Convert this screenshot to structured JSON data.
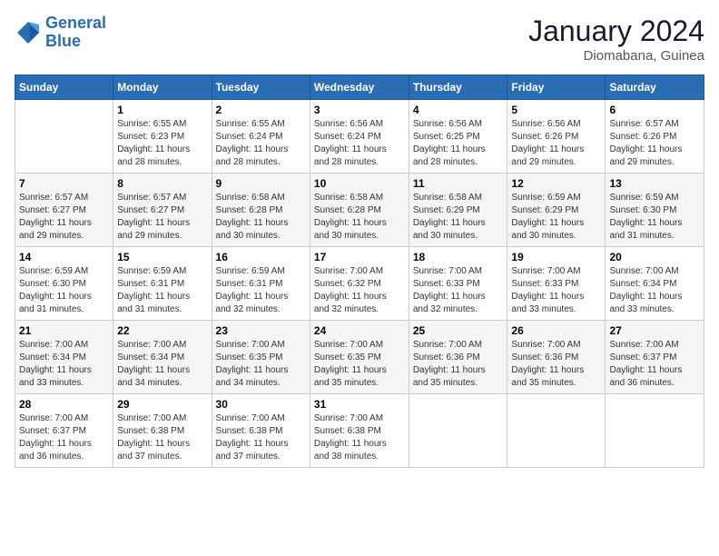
{
  "header": {
    "logo_line1": "General",
    "logo_line2": "Blue",
    "month_year": "January 2024",
    "location": "Diomabana, Guinea"
  },
  "calendar": {
    "days_of_week": [
      "Sunday",
      "Monday",
      "Tuesday",
      "Wednesday",
      "Thursday",
      "Friday",
      "Saturday"
    ],
    "weeks": [
      [
        {
          "day": null
        },
        {
          "day": 1,
          "sunrise": "6:55 AM",
          "sunset": "6:23 PM",
          "daylight": "11 hours and 28 minutes."
        },
        {
          "day": 2,
          "sunrise": "6:55 AM",
          "sunset": "6:24 PM",
          "daylight": "11 hours and 28 minutes."
        },
        {
          "day": 3,
          "sunrise": "6:56 AM",
          "sunset": "6:24 PM",
          "daylight": "11 hours and 28 minutes."
        },
        {
          "day": 4,
          "sunrise": "6:56 AM",
          "sunset": "6:25 PM",
          "daylight": "11 hours and 28 minutes."
        },
        {
          "day": 5,
          "sunrise": "6:56 AM",
          "sunset": "6:26 PM",
          "daylight": "11 hours and 29 minutes."
        },
        {
          "day": 6,
          "sunrise": "6:57 AM",
          "sunset": "6:26 PM",
          "daylight": "11 hours and 29 minutes."
        }
      ],
      [
        {
          "day": 7,
          "sunrise": "6:57 AM",
          "sunset": "6:27 PM",
          "daylight": "11 hours and 29 minutes."
        },
        {
          "day": 8,
          "sunrise": "6:57 AM",
          "sunset": "6:27 PM",
          "daylight": "11 hours and 29 minutes."
        },
        {
          "day": 9,
          "sunrise": "6:58 AM",
          "sunset": "6:28 PM",
          "daylight": "11 hours and 30 minutes."
        },
        {
          "day": 10,
          "sunrise": "6:58 AM",
          "sunset": "6:28 PM",
          "daylight": "11 hours and 30 minutes."
        },
        {
          "day": 11,
          "sunrise": "6:58 AM",
          "sunset": "6:29 PM",
          "daylight": "11 hours and 30 minutes."
        },
        {
          "day": 12,
          "sunrise": "6:59 AM",
          "sunset": "6:29 PM",
          "daylight": "11 hours and 30 minutes."
        },
        {
          "day": 13,
          "sunrise": "6:59 AM",
          "sunset": "6:30 PM",
          "daylight": "11 hours and 31 minutes."
        }
      ],
      [
        {
          "day": 14,
          "sunrise": "6:59 AM",
          "sunset": "6:30 PM",
          "daylight": "11 hours and 31 minutes."
        },
        {
          "day": 15,
          "sunrise": "6:59 AM",
          "sunset": "6:31 PM",
          "daylight": "11 hours and 31 minutes."
        },
        {
          "day": 16,
          "sunrise": "6:59 AM",
          "sunset": "6:31 PM",
          "daylight": "11 hours and 32 minutes."
        },
        {
          "day": 17,
          "sunrise": "7:00 AM",
          "sunset": "6:32 PM",
          "daylight": "11 hours and 32 minutes."
        },
        {
          "day": 18,
          "sunrise": "7:00 AM",
          "sunset": "6:33 PM",
          "daylight": "11 hours and 32 minutes."
        },
        {
          "day": 19,
          "sunrise": "7:00 AM",
          "sunset": "6:33 PM",
          "daylight": "11 hours and 33 minutes."
        },
        {
          "day": 20,
          "sunrise": "7:00 AM",
          "sunset": "6:34 PM",
          "daylight": "11 hours and 33 minutes."
        }
      ],
      [
        {
          "day": 21,
          "sunrise": "7:00 AM",
          "sunset": "6:34 PM",
          "daylight": "11 hours and 33 minutes."
        },
        {
          "day": 22,
          "sunrise": "7:00 AM",
          "sunset": "6:34 PM",
          "daylight": "11 hours and 34 minutes."
        },
        {
          "day": 23,
          "sunrise": "7:00 AM",
          "sunset": "6:35 PM",
          "daylight": "11 hours and 34 minutes."
        },
        {
          "day": 24,
          "sunrise": "7:00 AM",
          "sunset": "6:35 PM",
          "daylight": "11 hours and 35 minutes."
        },
        {
          "day": 25,
          "sunrise": "7:00 AM",
          "sunset": "6:36 PM",
          "daylight": "11 hours and 35 minutes."
        },
        {
          "day": 26,
          "sunrise": "7:00 AM",
          "sunset": "6:36 PM",
          "daylight": "11 hours and 35 minutes."
        },
        {
          "day": 27,
          "sunrise": "7:00 AM",
          "sunset": "6:37 PM",
          "daylight": "11 hours and 36 minutes."
        }
      ],
      [
        {
          "day": 28,
          "sunrise": "7:00 AM",
          "sunset": "6:37 PM",
          "daylight": "11 hours and 36 minutes."
        },
        {
          "day": 29,
          "sunrise": "7:00 AM",
          "sunset": "6:38 PM",
          "daylight": "11 hours and 37 minutes."
        },
        {
          "day": 30,
          "sunrise": "7:00 AM",
          "sunset": "6:38 PM",
          "daylight": "11 hours and 37 minutes."
        },
        {
          "day": 31,
          "sunrise": "7:00 AM",
          "sunset": "6:38 PM",
          "daylight": "11 hours and 38 minutes."
        },
        {
          "day": null
        },
        {
          "day": null
        },
        {
          "day": null
        }
      ]
    ]
  }
}
